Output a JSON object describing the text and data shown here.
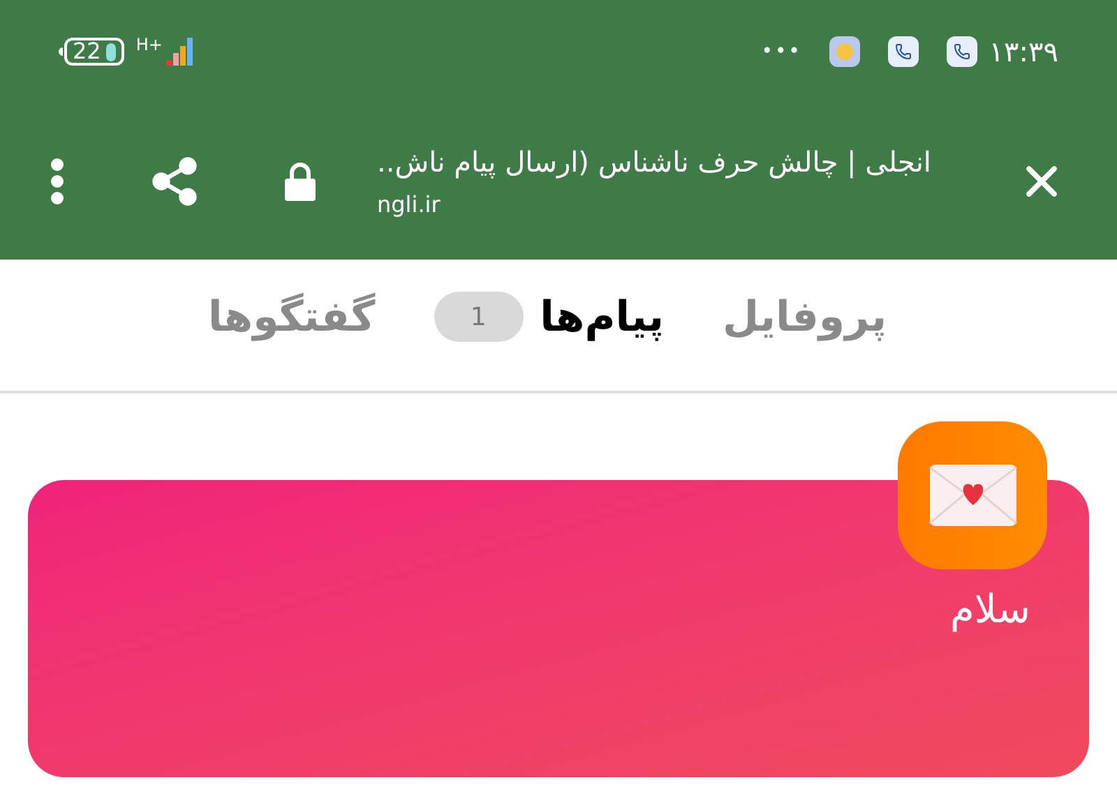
{
  "status_bar": {
    "battery": "22",
    "network": "H+",
    "time": "۱۳:۳۹",
    "overflow": "•••"
  },
  "toolbar": {
    "title": "انجلی | چالش حرف ناشناس (ارسال پیام ناش..",
    "url": "ngli.ir"
  },
  "tabs": [
    {
      "label": "پروفایل",
      "selected": false
    },
    {
      "label": "پیام‌ها",
      "selected": true,
      "badge": "1"
    },
    {
      "label": "گفتگوها",
      "selected": false
    }
  ],
  "message": {
    "text": "سلام"
  }
}
